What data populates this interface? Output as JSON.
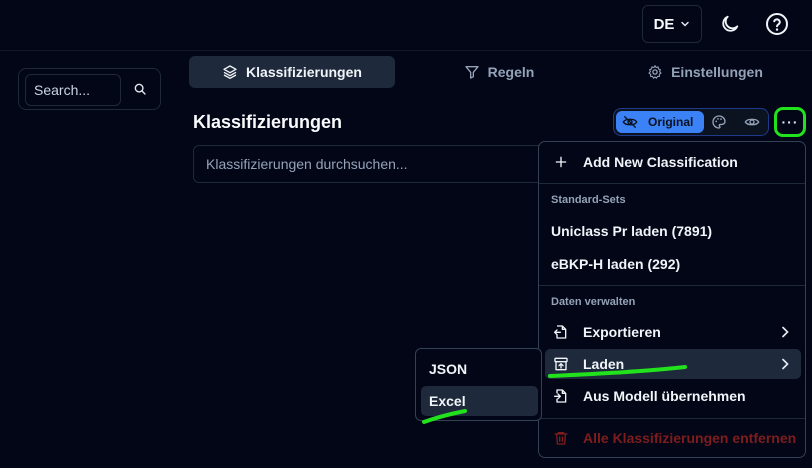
{
  "topbar": {
    "language": "DE",
    "icons": [
      "chevron-down-icon",
      "moon-icon",
      "help-circle-icon"
    ]
  },
  "sidebar": {
    "search_placeholder": "Search..."
  },
  "tabs": [
    {
      "label": "Klassifizierungen",
      "icon": "layers-icon",
      "active": true
    },
    {
      "label": "Regeln",
      "icon": "filter-icon",
      "active": false
    },
    {
      "label": "Einstellungen",
      "icon": "gear-icon",
      "active": false
    }
  ],
  "main": {
    "title": "Klassifizierungen",
    "search_placeholder": "Klassifizierungen durchsuchen..."
  },
  "view_toggle": {
    "original_label": "Original",
    "icons": [
      "eye-off-icon",
      "palette-icon",
      "eye-icon"
    ]
  },
  "more_button": {
    "label": "···"
  },
  "menu": {
    "add_label": "Add New Classification",
    "standard_sets_heading": "Standard-Sets",
    "uniclass_label": "Uniclass Pr laden (7891)",
    "ebkp_label": "eBKP-H laden (292)",
    "manage_heading": "Daten verwalten",
    "export_label": "Exportieren",
    "load_label": "Laden",
    "from_model_label": "Aus Modell übernehmen",
    "delete_all_label": "Alle Klassifizierungen entfernen"
  },
  "submenu": {
    "items": [
      "JSON",
      "Excel"
    ]
  },
  "colors": {
    "background": "#020617",
    "accent": "#3b82f6",
    "annotation": "#22e11d",
    "danger": "#7f1d1d"
  }
}
